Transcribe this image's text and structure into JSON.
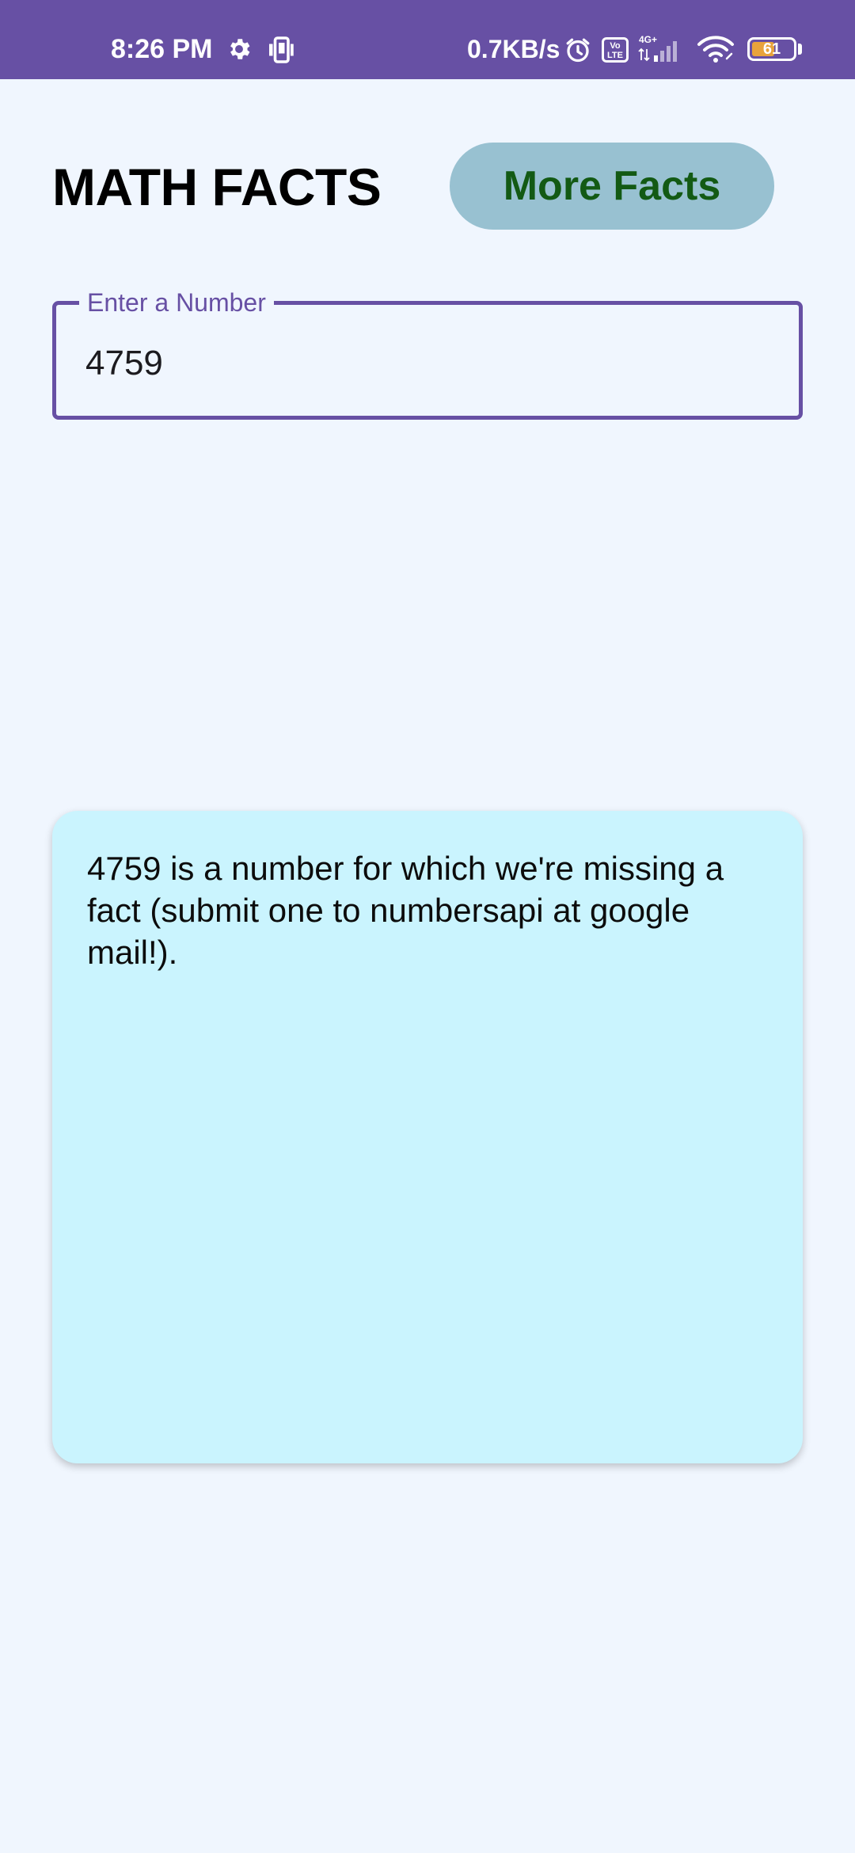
{
  "status_bar": {
    "time": "8:26 PM",
    "speed": "0.7KB/s",
    "volte": "Vo LTE",
    "battery": "61",
    "battery_level": 0.61,
    "icons": [
      "gear-icon",
      "phone-sync-icon",
      "alarm-icon",
      "volte-icon",
      "signal-icon",
      "wifi-icon",
      "battery-icon"
    ]
  },
  "header": {
    "title": "MATH FACTS",
    "more_button_label": "More Facts"
  },
  "number_field": {
    "label": "Enter a Number",
    "value": "4759"
  },
  "fact": {
    "text": "4759 is a number for which we're missing a fact (submit one to numbersapi at google mail!)."
  },
  "colors": {
    "status_bar": "#6750a4",
    "background": "#f0f6fe",
    "button_bg": "#98c1d1",
    "button_text": "#135a14",
    "field_outline": "#6750a4",
    "card_bg": "#caf4fe"
  }
}
